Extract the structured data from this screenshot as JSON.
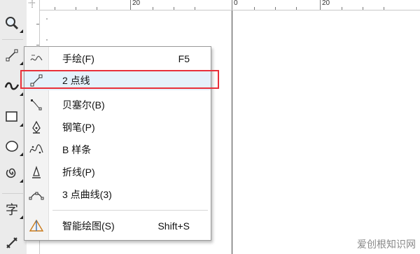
{
  "ruler": {
    "top_labels": [
      "20",
      "0",
      "20"
    ]
  },
  "toolbox": {
    "tools": [
      {
        "name": "zoom-tool",
        "icon": "magnifier-icon"
      },
      {
        "name": "line-tool",
        "icon": "two-point-line-icon",
        "active": true
      },
      {
        "name": "smart-fill-tool",
        "icon": "spiral-curve-icon"
      },
      {
        "name": "rectangle-tool",
        "icon": "rectangle-icon"
      },
      {
        "name": "ellipse-tool",
        "icon": "ellipse-icon"
      },
      {
        "name": "spiral-tool",
        "icon": "spiral-icon"
      },
      {
        "name": "text-tool",
        "icon": "text-icon"
      },
      {
        "name": "dimension-tool",
        "icon": "dimension-icon"
      }
    ],
    "text_tool_glyph": "字"
  },
  "menu": {
    "items": [
      {
        "label": "手绘(F)",
        "shortcut": "F5",
        "icon": "freehand-icon"
      },
      {
        "label": "2 点线",
        "shortcut": "",
        "icon": "two-point-line-icon",
        "selected": true
      },
      {
        "label": "贝塞尔(B)",
        "shortcut": "",
        "icon": "bezier-icon"
      },
      {
        "label": "钢笔(P)",
        "shortcut": "",
        "icon": "pen-nib-icon"
      },
      {
        "label": "B 样条",
        "shortcut": "",
        "icon": "b-spline-icon"
      },
      {
        "label": "折线(P)",
        "shortcut": "",
        "icon": "polyline-icon"
      },
      {
        "label": "3 点曲线(3)",
        "shortcut": "",
        "icon": "three-point-curve-icon"
      },
      {
        "label": "智能绘图(S)",
        "shortcut": "Shift+S",
        "icon": "smart-drawing-icon"
      }
    ]
  },
  "watermark": "爱创根知识网",
  "colors": {
    "highlight": "#e8303a",
    "selected_bg": "#e5f1fb"
  }
}
